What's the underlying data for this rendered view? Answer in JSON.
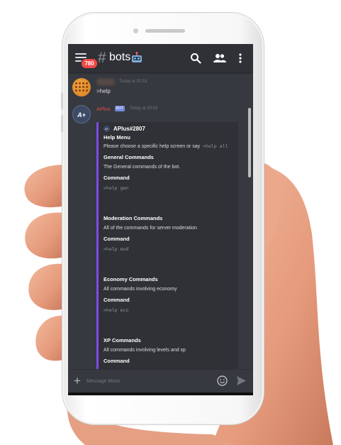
{
  "topbar": {
    "badge": "780",
    "hash": "#",
    "channel": "bots"
  },
  "messages": {
    "user": {
      "timestamp": "Today at 20:53",
      "text": ">help"
    },
    "bot": {
      "name": "APlus",
      "tag": "BOT",
      "timestamp": "Today at 20:53",
      "avatar_text": "A+",
      "embed": {
        "author": "APlus#2807",
        "title": "Help Menu",
        "description": "Please choose a specific help screen or say",
        "description_code": ">help all",
        "sections": [
          {
            "title": "General Commands",
            "text": "The General commands of the bot.",
            "label": "Command",
            "code": ">help gen"
          },
          {
            "title": "Moderation Commands",
            "text": "All of the commands for server moderation",
            "label": "Command",
            "code": ">help mod"
          },
          {
            "title": "Economy Commands",
            "text": "All commands involving economy",
            "label": "Command",
            "code": ">help eco"
          },
          {
            "title": "XP Commands",
            "text": "All commands involving levels and xp",
            "label": "Command",
            "code": ""
          }
        ]
      }
    }
  },
  "input": {
    "placeholder": "Message #bots"
  },
  "colors": {
    "accent": "#7d4ce8",
    "badge": "#f04747",
    "bot_tag": "#7289da",
    "bot_name": "#e5484d"
  }
}
